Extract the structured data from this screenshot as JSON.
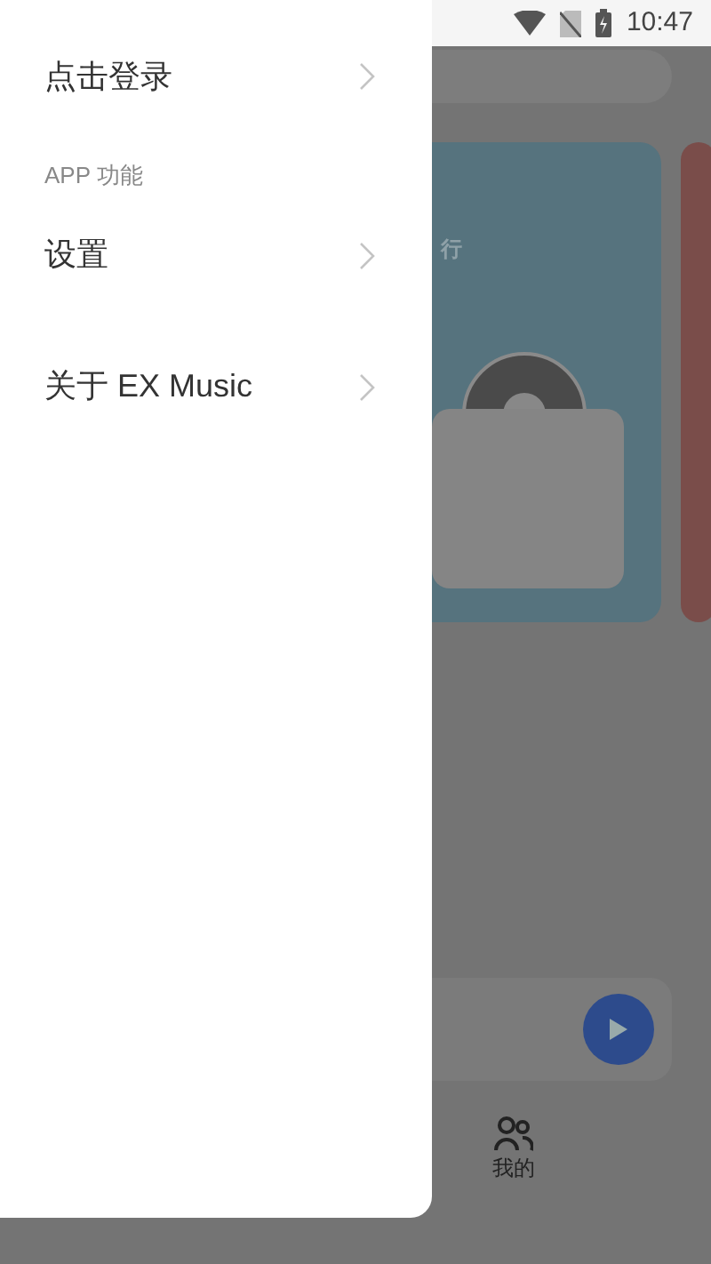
{
  "status_bar": {
    "time": "10:47"
  },
  "drawer": {
    "account": {
      "label": "点击登录"
    },
    "section": {
      "title": "APP 功能"
    },
    "items": [
      {
        "label": "设置"
      },
      {
        "label": "关于 EX Music"
      }
    ]
  },
  "background": {
    "banner": {
      "text": "行"
    },
    "bottom_nav": [
      {
        "label": "我的"
      }
    ]
  }
}
